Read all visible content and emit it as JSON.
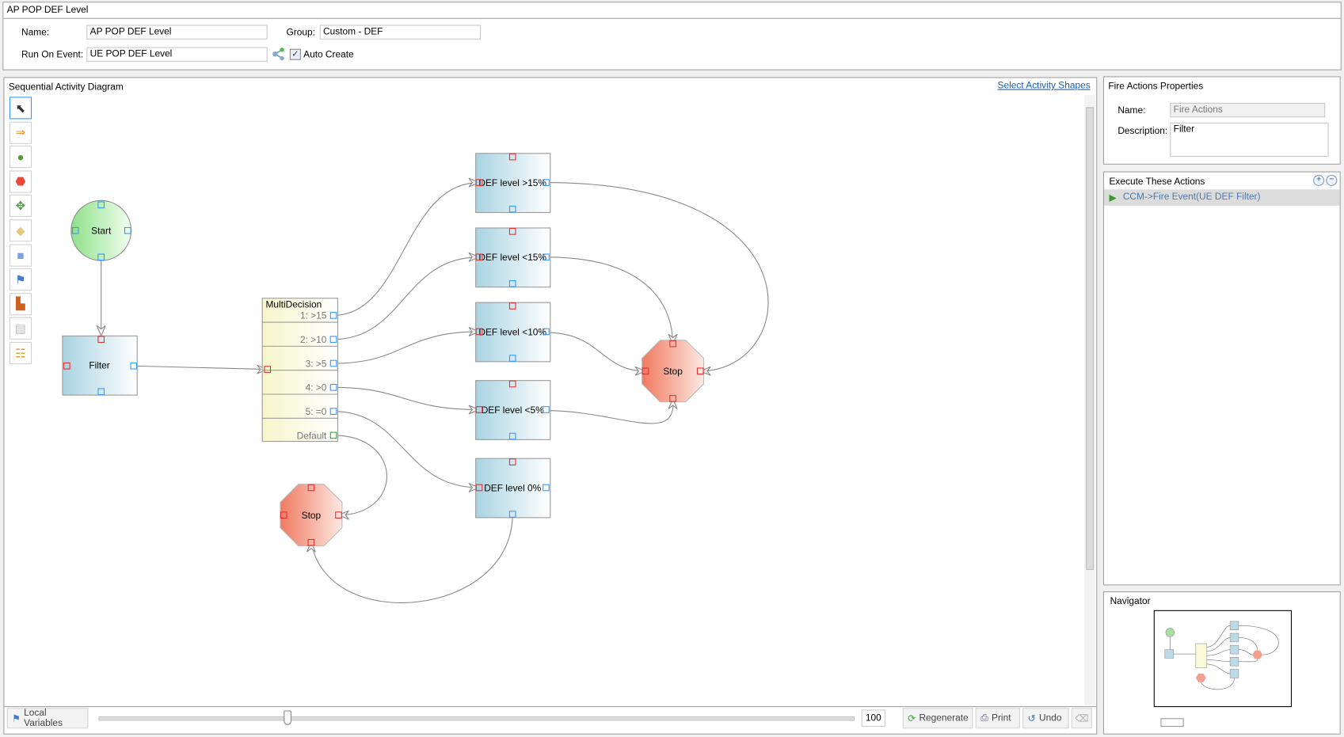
{
  "window": {
    "title": "AP POP DEF Level"
  },
  "form": {
    "name_label": "Name:",
    "name_value": "AP POP DEF Level",
    "group_label": "Group:",
    "group_value": "Custom - DEF",
    "event_label": "Run On Event:",
    "event_value": "UE POP DEF Level",
    "auto_create_label": "Auto Create",
    "auto_create_checked": true
  },
  "diagram": {
    "title": "Sequential Activity Diagram",
    "select_shapes_link": "Select Activity Shapes",
    "toolbox": [
      "pointer-icon",
      "arrow-icon",
      "start-icon",
      "stop-icon",
      "parallel-icon",
      "decision-icon",
      "activity-icon",
      "fire-action-icon",
      "assign-icon",
      "note-icon",
      "multidecision-icon"
    ],
    "nodes": {
      "start": "Start",
      "filter": "Filter",
      "multidecision": {
        "title": "MultiDecision",
        "rows": [
          "1: >15",
          "2: >10",
          "3: >5",
          "4: >0",
          "5: =0",
          "Default"
        ]
      },
      "def_levels": [
        "DEF level >15%",
        "DEF level <15%",
        "DEF level <10%",
        "DEF level <5%",
        "DEF level 0%"
      ],
      "stop_right": "Stop",
      "stop_bottom": "Stop"
    },
    "colors": {
      "connector_in": "#e03030",
      "connector_out": "#3399ff",
      "connector_default": "#33aa33"
    }
  },
  "bottom_bar": {
    "local_variables": "Local Variables",
    "zoom_value": "100",
    "zoom_slider_fraction": 0.25,
    "regenerate": "Regenerate",
    "print": "Print",
    "undo": "Undo"
  },
  "properties": {
    "title": "Fire Actions Properties",
    "name_label": "Name:",
    "name_value": "Fire Actions",
    "description_label": "Description:",
    "description_value": "Filter"
  },
  "actions": {
    "title": "Execute These Actions",
    "items": [
      "CCM->Fire Event(UE DEF Filter)"
    ]
  },
  "navigator": {
    "title": "Navigator"
  }
}
